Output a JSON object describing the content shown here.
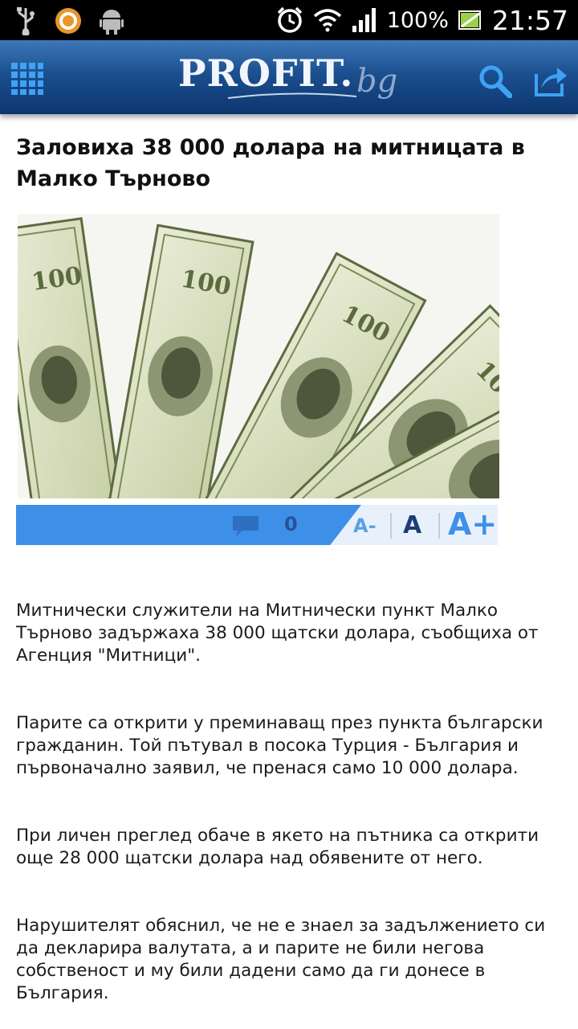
{
  "status_bar": {
    "icons": [
      "usb-icon",
      "app-notification-icon",
      "android-debug-icon",
      "alarm-icon",
      "wifi-icon",
      "signal-icon",
      "battery-charging-icon"
    ],
    "battery": "100%",
    "time": "21:57"
  },
  "header": {
    "logo_main": "PROFIT.",
    "logo_sub": "bg",
    "menu_icon": "grid-menu-icon",
    "search_icon": "search-icon",
    "share_icon": "share-icon",
    "colors": {
      "bar_top": "#3d78b8",
      "bar_bottom": "#0d3670",
      "icon": "#3fa2f2"
    }
  },
  "article": {
    "title": "Заловиха 38 000 долара на митницата в Малко Търново",
    "image_alt": "dollar-bills-photo",
    "toolbar": {
      "comment_count": "0",
      "font_decrease": "A-",
      "font_normal": "A",
      "font_increase": "A+"
    },
    "paragraphs": [
      "Митнически служители на Митнически пункт Малко Търново задържаха 38 000 щатски долара, съобщиха от Агенция \"Митници\".",
      "Парите са открити у преминаващ през пункта български гражданин. Той пътувал в посока Турция - България и първоначално заявил, че пренася само 10 000 долара.",
      "При личен преглед обаче в якето на пътника са открити още 28 000 щатски долара над обявените от него.",
      "Нарушителят обяснил, че не е знаел за задължението си да декларира валутата, а и парите не били негова собственост и му били дадени само да ги донесе в България."
    ]
  }
}
